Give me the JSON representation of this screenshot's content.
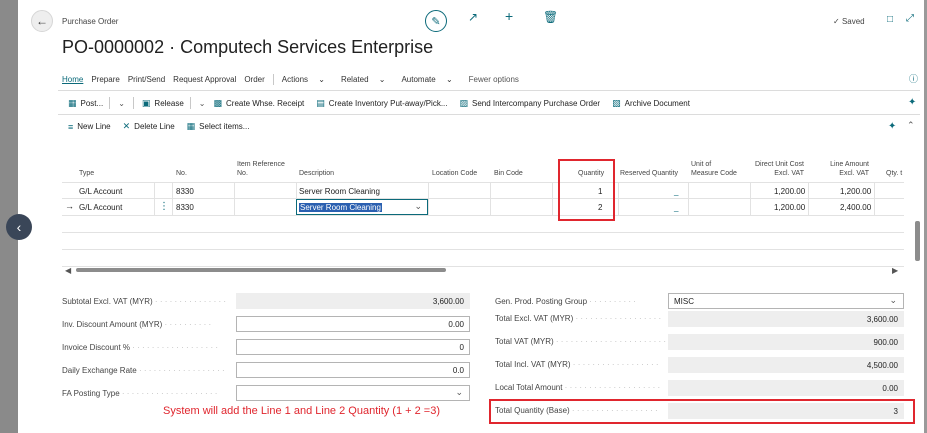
{
  "header": {
    "breadcrumb": "Purchase Order",
    "title": "PO-0000002 · Computech Services Enterprise",
    "saved_label": "Saved"
  },
  "action_bar": {
    "items": [
      "Home",
      "Prepare",
      "Print/Send",
      "Request Approval",
      "Order"
    ],
    "menus": [
      "Actions",
      "Related",
      "Automate"
    ],
    "fewer_options": "Fewer options"
  },
  "toolbar1": {
    "post": "Post...",
    "release": "Release",
    "create_whse_receipt": "Create Whse. Receipt",
    "create_inventory": "Create Inventory Put-away/Pick...",
    "send_intercompany": "Send Intercompany Purchase Order",
    "archive_document": "Archive Document"
  },
  "toolbar2": {
    "new_line": "New Line",
    "delete_line": "Delete Line",
    "select_items": "Select items..."
  },
  "lines": {
    "headers": {
      "type": "Type",
      "no": "No.",
      "item_ref_1": "Item Reference",
      "item_ref_2": "No.",
      "description": "Description",
      "location_code": "Location Code",
      "bin_code": "Bin Code",
      "quantity": "Quantity",
      "reserved_quantity": "Reserved Quantity",
      "uom_1": "Unit of",
      "uom_2": "Measure Code",
      "direct_cost_1": "Direct Unit Cost",
      "direct_cost_2": "Excl. VAT",
      "line_amount_1": "Line Amount",
      "line_amount_2": "Excl. VAT",
      "qty_trunc": "Qty. t"
    },
    "rows": [
      {
        "type": "G/L Account",
        "no": "8330",
        "description": "Server Room Cleaning",
        "quantity": "1",
        "reserved": "_",
        "direct_cost": "1,200.00",
        "line_amount": "1,200.00"
      },
      {
        "type": "G/L Account",
        "no": "8330",
        "description": "Server Room Cleaning",
        "quantity": "2",
        "reserved": "_",
        "direct_cost": "1,200.00",
        "line_amount": "2,400.00"
      }
    ]
  },
  "totals_left": {
    "subtotal_label": "Subtotal Excl. VAT (MYR)",
    "subtotal_value": "3,600.00",
    "inv_discount_label": "Inv. Discount Amount (MYR)",
    "inv_discount_value": "0.00",
    "invoice_discount_pct_label": "Invoice Discount %",
    "invoice_discount_pct_value": "0",
    "daily_exchange_label": "Daily Exchange Rate",
    "daily_exchange_value": "0.0",
    "fa_posting_label": "FA Posting Type",
    "fa_posting_value": ""
  },
  "totals_right": {
    "gen_prod_label": "Gen. Prod. Posting Group",
    "gen_prod_value": "MISC",
    "total_excl_label": "Total Excl. VAT (MYR)",
    "total_excl_value": "3,600.00",
    "total_vat_label": "Total VAT (MYR)",
    "total_vat_value": "900.00",
    "total_incl_label": "Total Incl. VAT (MYR)",
    "total_incl_value": "4,500.00",
    "local_total_label": "Local Total Amount",
    "local_total_value": "0.00",
    "total_qty_label": "Total Quantity (Base)",
    "total_qty_value": "3"
  },
  "annotation": "System will add the Line 1 and Line 2 Quantity (1 + 2 =3)",
  "colors": {
    "accent": "#0b6a7a",
    "highlight_red": "#e0262e"
  }
}
